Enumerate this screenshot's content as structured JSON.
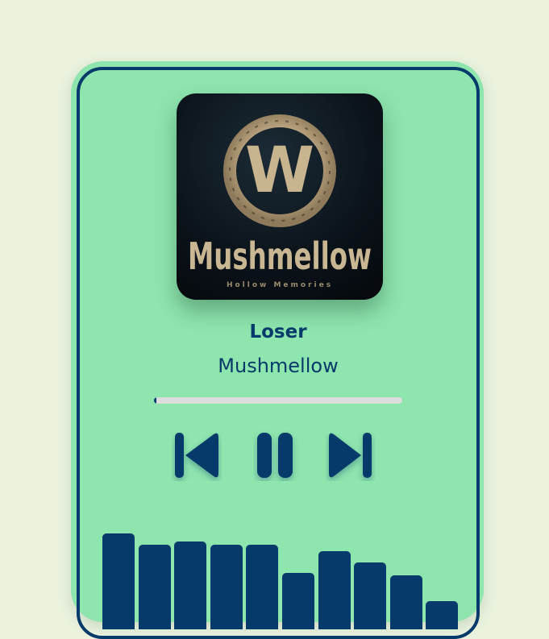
{
  "player": {
    "song_title": "Loser",
    "artist": "Mushmellow",
    "cover": {
      "title": "Mushmellow",
      "subtitle": "Hollow Memories",
      "emblem_letter": "W"
    },
    "progress_fraction": 0.01,
    "controls": {
      "previous_icon": "skip-previous-icon",
      "pause_icon": "pause-icon",
      "next_icon": "skip-next-icon"
    },
    "visualizer_levels": [
      0.85,
      0.75,
      0.78,
      0.75,
      0.75,
      0.5,
      0.69,
      0.59,
      0.48,
      0.25
    ]
  },
  "colors": {
    "background": "#ebf3df",
    "card": "#8ee5ae",
    "accent": "#053a6a",
    "progress_track": "#dcdcdc"
  }
}
